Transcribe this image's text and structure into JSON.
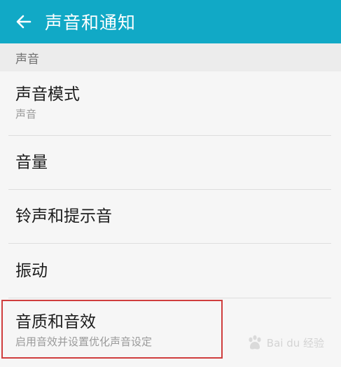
{
  "app_bar": {
    "title": "声音和通知",
    "back_icon": "arrow-left-icon",
    "background_color": "#11a9c6"
  },
  "section": {
    "header": "声音"
  },
  "items": [
    {
      "title": "声音模式",
      "subtitle": "声音"
    },
    {
      "title": "音量"
    },
    {
      "title": "铃声和提示音"
    },
    {
      "title": "振动"
    },
    {
      "title": "音质和音效",
      "subtitle": "启用音效并设置优化声音设定"
    }
  ],
  "annotation": {
    "highlight_color": "#cf3e3e"
  },
  "watermark": {
    "text": "Bai du 经验",
    "icon": "baidu-paw-icon"
  }
}
